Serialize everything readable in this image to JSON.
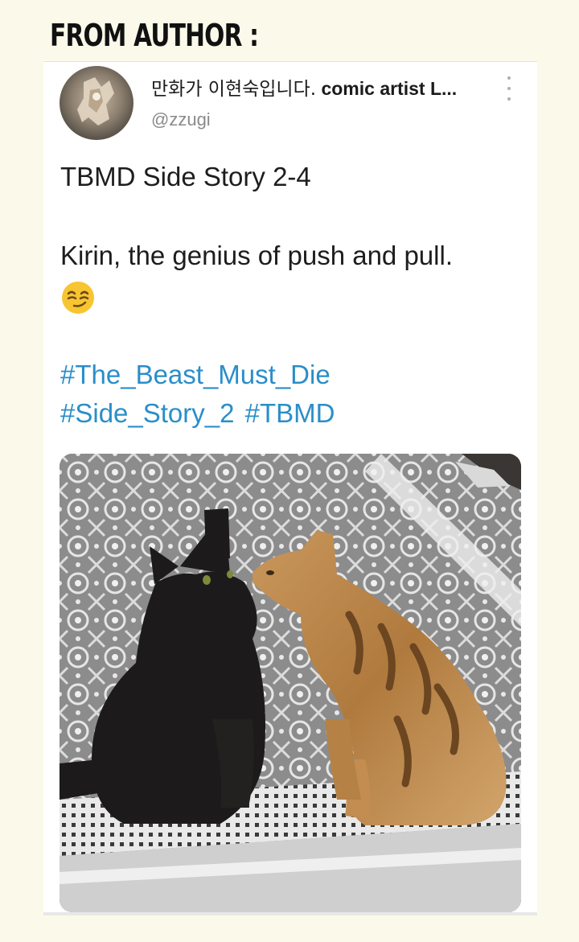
{
  "header": {
    "label": "FROM AUTHOR :"
  },
  "tweet": {
    "display_name_korean": "만화가 이현숙입니다.",
    "display_name_latin": " comic artist L...",
    "handle": "@zzugi",
    "lines": [
      "TBMD Side Story 2-4",
      "Kirin, the genius of push and pull."
    ],
    "emoji": "smirking-face",
    "hashtags_line1": [
      "#The_Beast_Must_Die"
    ],
    "hashtags_line2": [
      "#Side_Story_2",
      "#TBMD"
    ]
  },
  "icons": {
    "more": "more-vertical-icon",
    "avatar": "author-avatar"
  },
  "colors": {
    "background": "#fbfaea",
    "card": "#ffffff",
    "text": "#1d1d1d",
    "handle": "#8a8a8a",
    "hashtag": "#2a8ec9"
  },
  "photo": {
    "subject": "black cat and tabby cat on patterned rug"
  }
}
